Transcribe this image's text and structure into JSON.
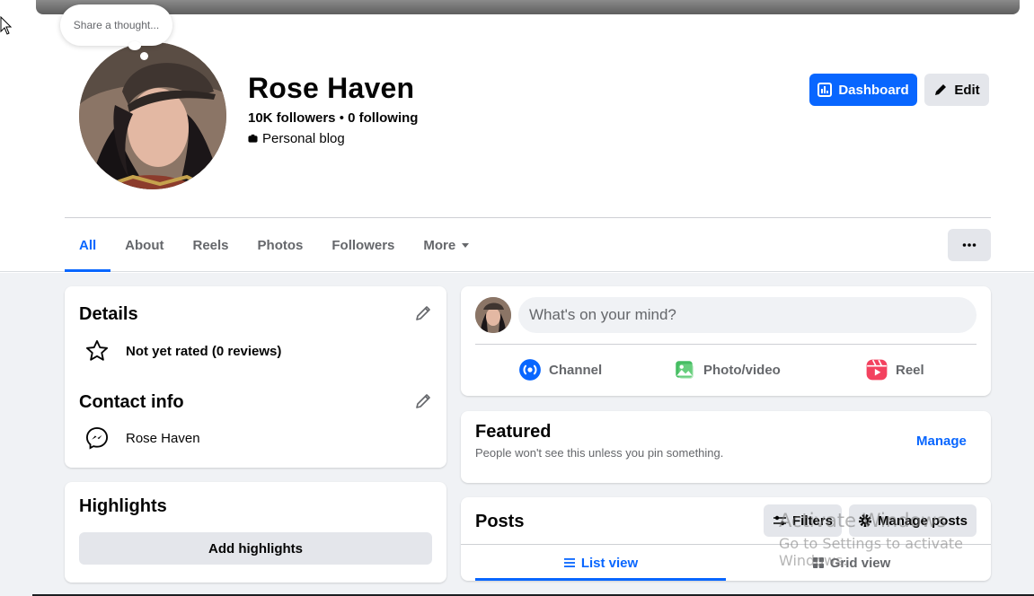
{
  "profile": {
    "thought_placeholder": "Share a thought...",
    "name": "Rose Haven",
    "followers": "10K followers",
    "separator": " • ",
    "following": "0 following",
    "category": "Personal blog",
    "dashboard_label": "Dashboard",
    "edit_label": "Edit"
  },
  "tabs": [
    {
      "label": "All",
      "active": true
    },
    {
      "label": "About"
    },
    {
      "label": "Reels"
    },
    {
      "label": "Photos"
    },
    {
      "label": "Followers"
    },
    {
      "label": "More"
    }
  ],
  "details": {
    "title": "Details",
    "rating": "Not yet rated (0 reviews)"
  },
  "contact": {
    "title": "Contact info",
    "messenger": "Rose Haven"
  },
  "highlights": {
    "title": "Highlights",
    "add_label": "Add highlights"
  },
  "composer": {
    "placeholder": "What's on your mind?",
    "actions": [
      {
        "label": "Channel",
        "icon": "channel-icon",
        "color": "#0866ff"
      },
      {
        "label": "Photo/video",
        "icon": "photo-icon",
        "color": "#45bd62"
      },
      {
        "label": "Reel",
        "icon": "reel-icon",
        "color": "#f3425f"
      }
    ]
  },
  "featured": {
    "title": "Featured",
    "subtitle": "People won't see this unless you pin something.",
    "manage": "Manage"
  },
  "posts": {
    "title": "Posts",
    "filters": "Filters",
    "manage_posts": "Manage posts",
    "list_view": "List view",
    "grid_view": "Grid view"
  },
  "watermark": {
    "line1": "Activate Windows",
    "line2": "Go to Settings to activate Windows."
  },
  "colors": {
    "accent": "#0866ff",
    "button_gray": "#e4e6eb",
    "page_bg": "#f0f2f5",
    "secondary_text": "#65676b"
  }
}
